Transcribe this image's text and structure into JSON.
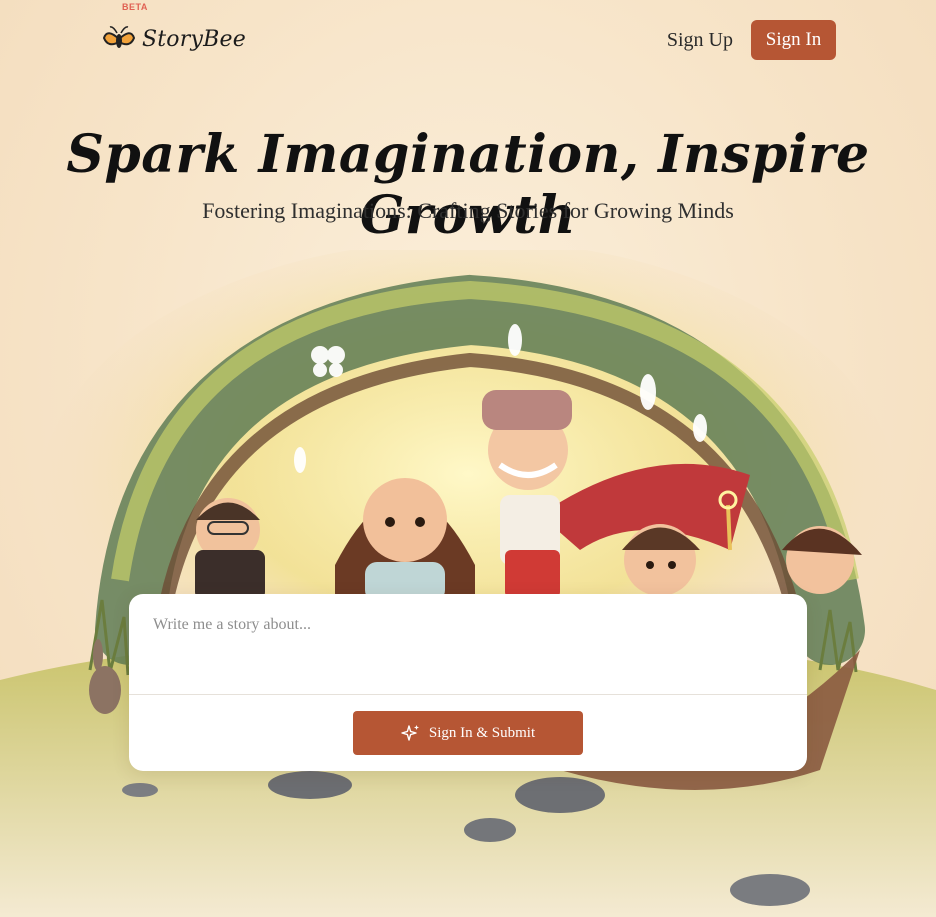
{
  "brand": {
    "name": "StoryBee",
    "badge": "BETA"
  },
  "nav": {
    "sign_up": "Sign Up",
    "sign_in": "Sign In"
  },
  "hero": {
    "title": "Spark Imagination, Inspire Growth",
    "subtitle": "Fostering Imaginations: Crafting Stories for Growing Minds"
  },
  "story_form": {
    "placeholder": "Write me a story about...",
    "value": "",
    "submit_label": "Sign In & Submit"
  },
  "icons": {
    "logo": "bee-logo-icon",
    "submit": "sparkles-icon"
  },
  "colors": {
    "accent": "#b65634",
    "beta": "#e06153",
    "background": "#f8e9d2"
  }
}
